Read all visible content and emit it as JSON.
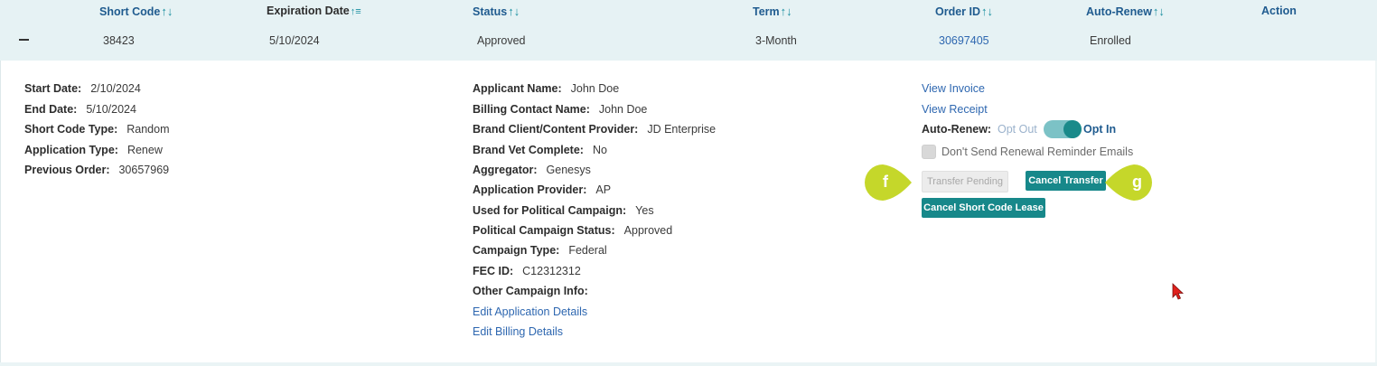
{
  "table": {
    "headers": {
      "short_code": "Short Code",
      "expiration_date": "Expiration Date",
      "status": "Status",
      "term": "Term",
      "order_id": "Order ID",
      "auto_renew": "Auto-Renew",
      "action": "Action"
    },
    "sort_icon": "↑↓",
    "sort_icon_alt": "↑≡",
    "row": {
      "short_code": "38423",
      "expiration_date": "5/10/2024",
      "status": "Approved",
      "term": "3-Month",
      "order_id": "30697405",
      "auto_renew": "Enrolled"
    }
  },
  "details": {
    "col1": [
      {
        "label": "Start Date:",
        "value": "2/10/2024"
      },
      {
        "label": "End Date:",
        "value": "5/10/2024"
      },
      {
        "label": "Short Code Type:",
        "value": "Random"
      },
      {
        "label": "Application Type:",
        "value": "Renew"
      },
      {
        "label": "Previous Order:",
        "value": "30657969"
      }
    ],
    "col2": [
      {
        "label": "Applicant Name:",
        "value": "John Doe"
      },
      {
        "label": "Billing Contact Name:",
        "value": "John Doe"
      },
      {
        "label": "Brand Client/Content Provider:",
        "value": "JD Enterprise"
      },
      {
        "label": "Brand Vet Complete:",
        "value": "No"
      },
      {
        "label": "Aggregator:",
        "value": "Genesys"
      },
      {
        "label": "Application Provider:",
        "value": "AP"
      },
      {
        "label": "Used for Political Campaign:",
        "value": "Yes"
      },
      {
        "label": "Political Campaign Status:",
        "value": "Approved"
      },
      {
        "label": "Campaign Type:",
        "value": "Federal"
      },
      {
        "label": "FEC ID:",
        "value": "C12312312"
      },
      {
        "label": "Other Campaign Info:",
        "value": ""
      }
    ],
    "links": {
      "edit_application": "Edit Application Details",
      "edit_billing": "Edit Billing Details",
      "view_invoice": "View Invoice",
      "view_receipt": "View Receipt"
    },
    "auto_renew": {
      "label": "Auto-Renew:",
      "opt_out": "Opt Out",
      "opt_in": "Opt In",
      "state": "on"
    },
    "reminder_checkbox_label": "Don't Send Renewal Reminder Emails",
    "buttons": {
      "transfer_pending": "Transfer Pending",
      "cancel_transfer": "Cancel Transfer",
      "cancel_lease": "Cancel Short Code Lease"
    },
    "callouts": {
      "f": "f",
      "g": "g"
    }
  },
  "colors": {
    "header_band": "#e6f2f4",
    "link": "#2e67b0",
    "teal_button": "#17888a",
    "callout": "#c5d72a",
    "cursor": "#e0201c"
  }
}
